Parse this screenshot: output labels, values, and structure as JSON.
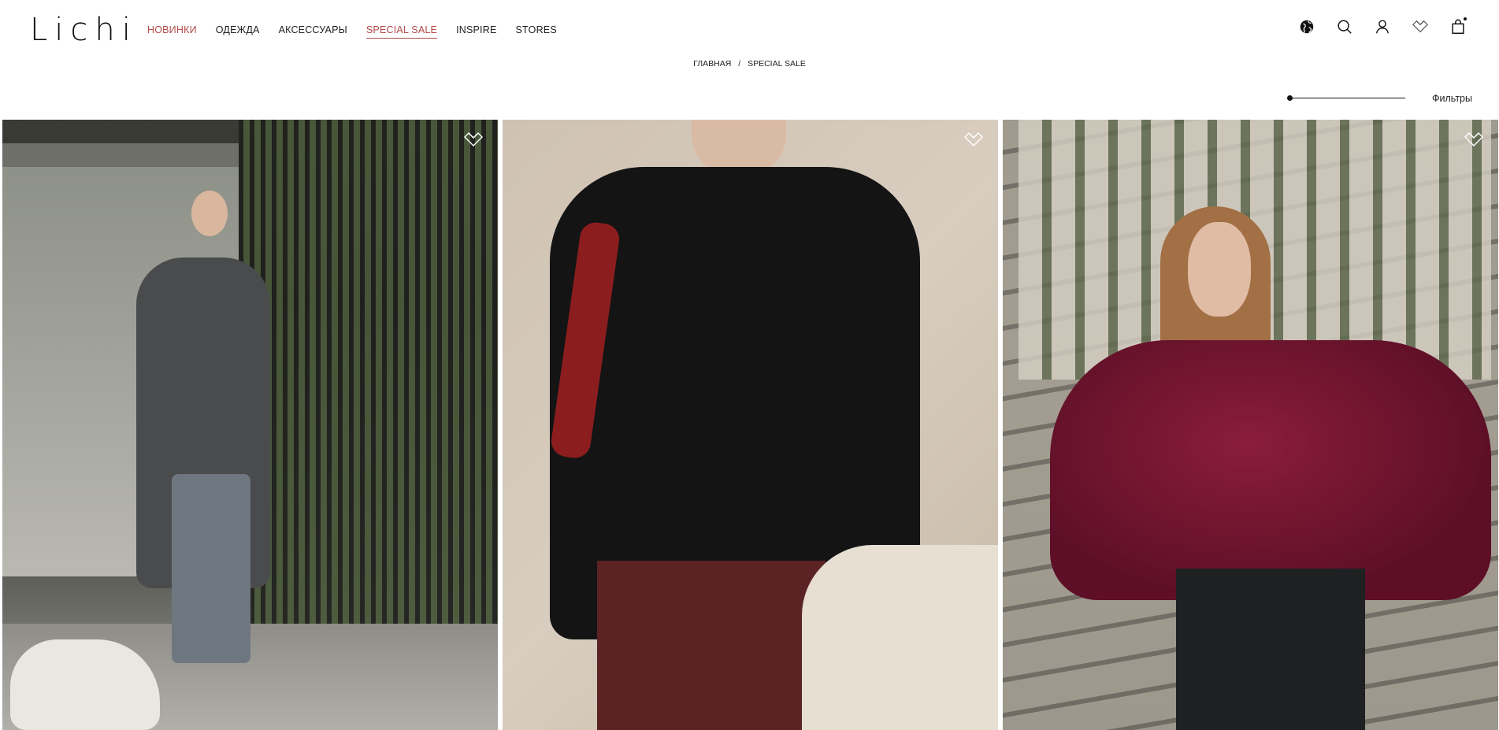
{
  "header": {
    "logo": "Lichi",
    "nav": [
      {
        "label": "НОВИНКИ",
        "accent": true,
        "underline": false
      },
      {
        "label": "ОДЕЖДА",
        "accent": false,
        "underline": false
      },
      {
        "label": "АКСЕССУАРЫ",
        "accent": false,
        "underline": false
      },
      {
        "label": "SPECIAL SALE",
        "accent": true,
        "underline": true
      },
      {
        "label": "INSPIRE",
        "accent": false,
        "underline": false
      },
      {
        "label": "STORES",
        "accent": false,
        "underline": false
      }
    ],
    "icons": [
      "globe-icon",
      "search-icon",
      "account-icon",
      "wishlist-icon",
      "cart-icon"
    ]
  },
  "breadcrumb": {
    "home": "ГЛАВНАЯ",
    "separator": "/",
    "current": "SPECIAL SALE"
  },
  "filters": {
    "label": "Фильтры",
    "grid_size_level": 0
  },
  "products": [
    {
      "image": "woman-grey-coat-with-dog",
      "favorite": false
    },
    {
      "image": "woman-black-cardigan-red-bag",
      "favorite": false
    },
    {
      "image": "woman-burgundy-ruffle-blouse",
      "favorite": false
    }
  ],
  "colors": {
    "accent": "#b24a4a",
    "text": "#1a1a1a",
    "background": "#ffffff"
  }
}
